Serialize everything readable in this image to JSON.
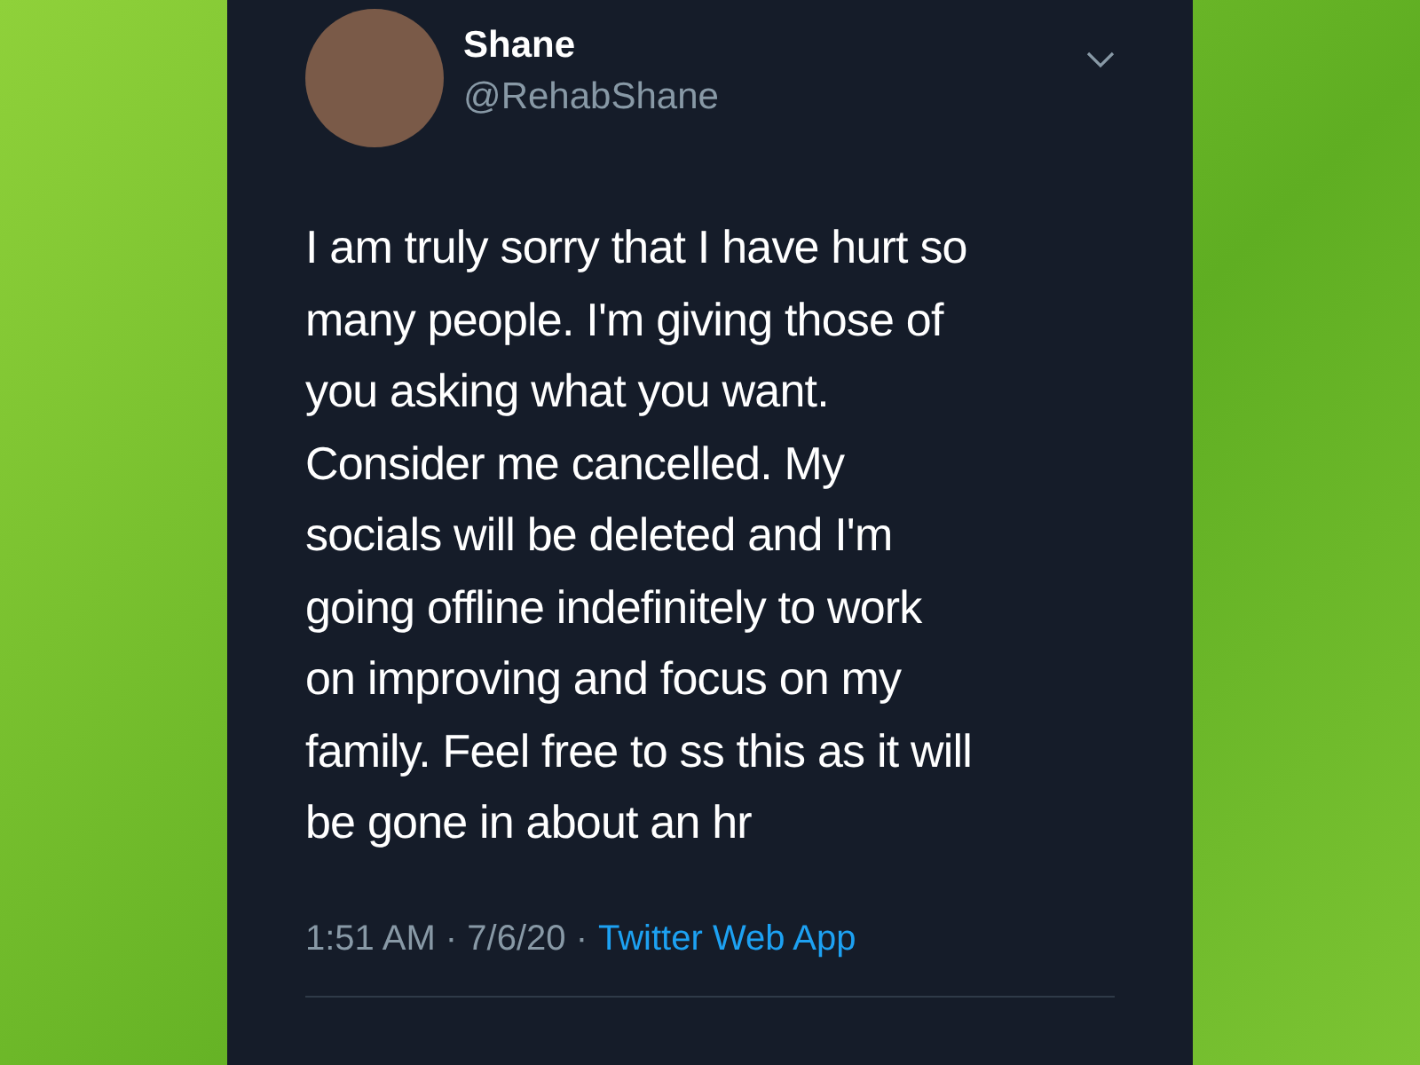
{
  "tweet": {
    "author": {
      "name": "Shane",
      "handle": "@RehabShane"
    },
    "text_lines": [
      "I am truly sorry that I have hurt so",
      "many people. I'm giving those of",
      "you asking what you want.",
      "Consider me cancelled. My",
      "socials will be deleted and I'm",
      "going offline indefinitely to work",
      "on improving and focus on my",
      "family. Feel free to ss this as it will",
      "be gone in about an hr"
    ],
    "timestamp": "1:51 AM · 7/6/20 ·",
    "source": "Twitter Web App"
  }
}
